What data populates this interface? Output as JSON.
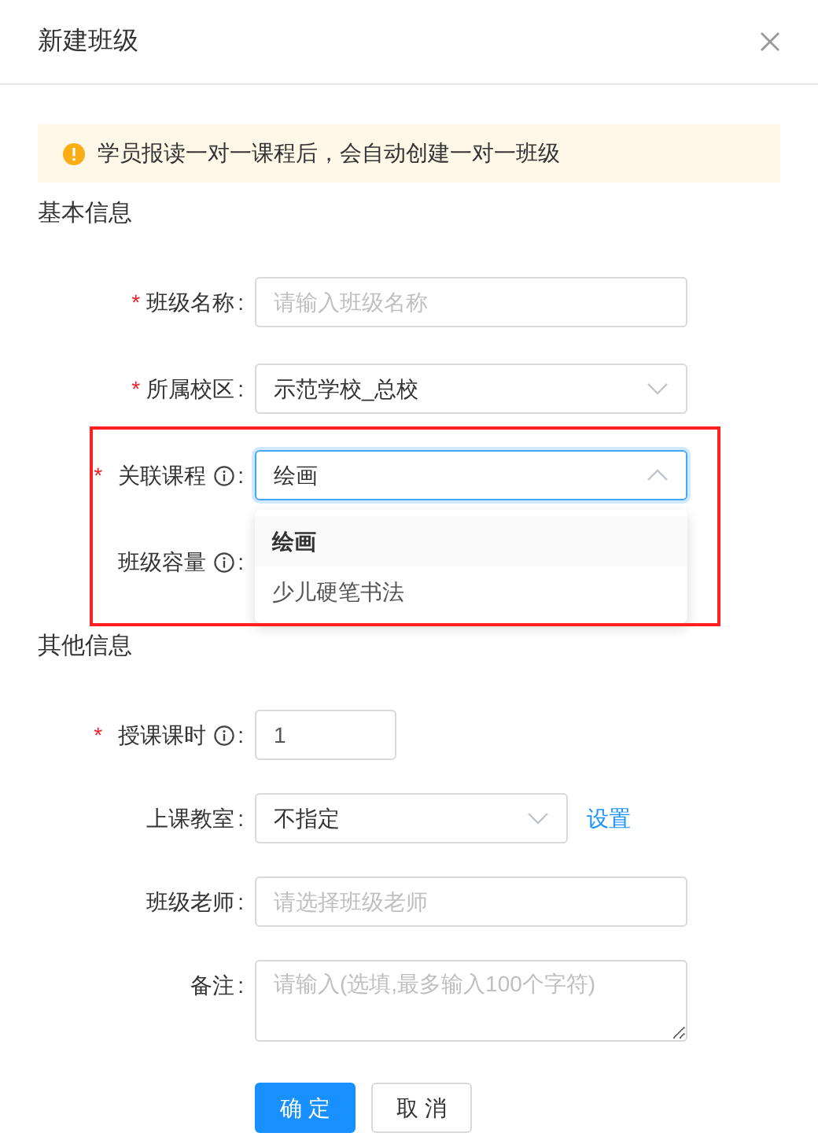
{
  "dialog": {
    "title": "新建班级"
  },
  "notice": {
    "text": "学员报读一对一课程后，会自动创建一对一班级"
  },
  "required_mark": "*",
  "sections": [
    {
      "title": "基本信息",
      "annotated": true,
      "fields": [
        {
          "label": "班级名称",
          "colon": ":",
          "required": true,
          "info": false,
          "kind": "input",
          "placeholder": "请输入班级名称"
        },
        {
          "label": "所属校区",
          "colon": ":",
          "required": true,
          "info": false,
          "kind": "select",
          "value": "示范学校_总校",
          "expanded": false
        },
        {
          "label": "关联课程",
          "colon": ":",
          "required": true,
          "info": true,
          "kind": "select",
          "value": "绘画",
          "expanded": true,
          "options": [
            {
              "label": "绘画",
              "selected": true
            },
            {
              "label": "少儿硬笔书法",
              "selected": false
            }
          ]
        },
        {
          "label": "班级容量",
          "colon": ":",
          "required": false,
          "info": true,
          "kind": "covered"
        }
      ]
    },
    {
      "title": "其他信息",
      "annotated": false,
      "fields": [
        {
          "label": "授课课时",
          "colon": ":",
          "required": true,
          "info": true,
          "kind": "number",
          "value": "1"
        },
        {
          "label": "上课教室",
          "colon": ":",
          "required": false,
          "info": false,
          "kind": "select",
          "value": "不指定",
          "expanded": false,
          "link": "设置"
        },
        {
          "label": "班级老师",
          "colon": ":",
          "required": false,
          "info": false,
          "kind": "input",
          "placeholder": "请选择班级老师"
        },
        {
          "label": "备注",
          "colon": ":",
          "required": false,
          "info": false,
          "kind": "textarea",
          "placeholder": "请输入(选填,最多输入100个字符)"
        }
      ]
    }
  ],
  "buttons": [
    {
      "label": "确 定",
      "primary": true
    },
    {
      "label": "取 消",
      "primary": false
    }
  ]
}
